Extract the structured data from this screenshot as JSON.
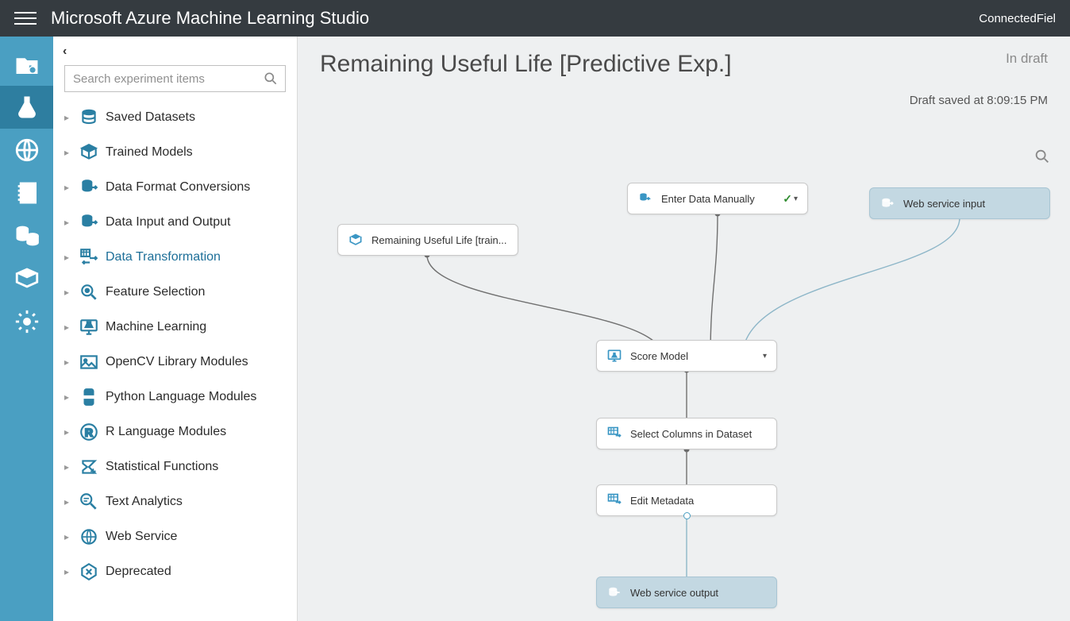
{
  "topbar": {
    "product_title": "Microsoft Azure Machine Learning Studio",
    "account": "ConnectedFiel"
  },
  "leftnav": {
    "items": [
      {
        "name": "projects"
      },
      {
        "name": "experiments",
        "selected": true
      },
      {
        "name": "web-services"
      },
      {
        "name": "notebooks"
      },
      {
        "name": "datasets"
      },
      {
        "name": "trained-models"
      },
      {
        "name": "settings"
      }
    ]
  },
  "palette": {
    "search_placeholder": "Search experiment items",
    "categories": [
      {
        "label": "Saved Datasets",
        "icon": "db-stack"
      },
      {
        "label": "Trained Models",
        "icon": "box"
      },
      {
        "label": "Data Format Conversions",
        "icon": "db-arrow"
      },
      {
        "label": "Data Input and Output",
        "icon": "db-arrow"
      },
      {
        "label": "Data Transformation",
        "icon": "transform",
        "active": true
      },
      {
        "label": "Feature Selection",
        "icon": "magnify"
      },
      {
        "label": "Machine Learning",
        "icon": "screen-flask"
      },
      {
        "label": "OpenCV Library Modules",
        "icon": "image"
      },
      {
        "label": "Python Language Modules",
        "icon": "python"
      },
      {
        "label": "R Language Modules",
        "icon": "r"
      },
      {
        "label": "Statistical Functions",
        "icon": "sigma"
      },
      {
        "label": "Text Analytics",
        "icon": "text-mag"
      },
      {
        "label": "Web Service",
        "icon": "globe"
      },
      {
        "label": "Deprecated",
        "icon": "x-box"
      }
    ]
  },
  "canvas": {
    "title": "Remaining Useful Life [Predictive Exp.]",
    "status": "In draft",
    "saved_msg": "Draft saved at 8:09:15 PM"
  },
  "nodes": {
    "trained": {
      "label": "Remaining Useful Life [train..."
    },
    "enter_data": {
      "label": "Enter Data Manually"
    },
    "ws_in": {
      "label": "Web service input"
    },
    "score": {
      "label": "Score Model"
    },
    "select_cols": {
      "label": "Select Columns in Dataset"
    },
    "edit_meta": {
      "label": "Edit Metadata"
    },
    "ws_out": {
      "label": "Web service output"
    }
  }
}
